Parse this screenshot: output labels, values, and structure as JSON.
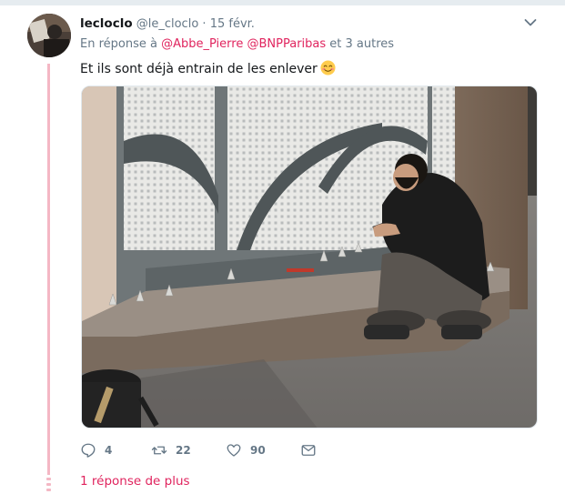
{
  "tweet": {
    "display_name": "lecloclo",
    "handle": "@le_cloclo",
    "separator": "·",
    "date": "15 févr.",
    "reply_prefix": "En réponse à",
    "mention_1": "@Abbe_Pierre",
    "mention_2": "@BNPParibas",
    "reply_suffix": "et 3 autres",
    "text": "Et ils sont déjà entrain de les enlever",
    "emoji": "smiling-face-emoji"
  },
  "actions": {
    "reply_count": "4",
    "retweet_count": "22",
    "like_count": "90"
  },
  "thread": {
    "more_replies": "1 réponse de plus"
  },
  "colors": {
    "accent": "#e0245e",
    "thread_line": "#f4b7c4",
    "muted": "#657786",
    "text": "#14171a"
  },
  "icons": {
    "reply": "reply-icon",
    "retweet": "retweet-icon",
    "like": "heart-icon",
    "dm": "message-icon",
    "menu": "chevron-down-icon"
  }
}
